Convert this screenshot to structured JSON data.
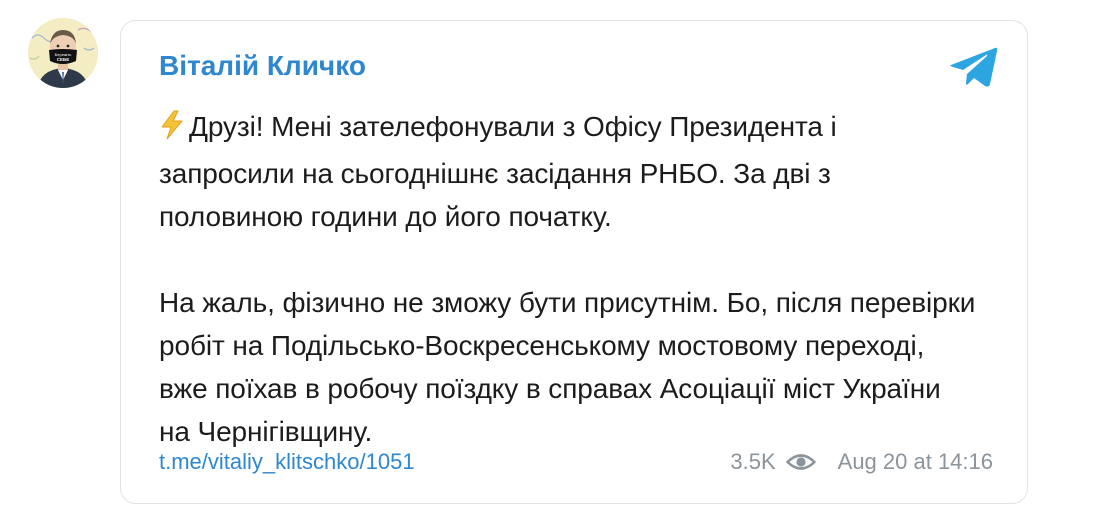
{
  "post": {
    "author_name": "Віталій Кличко",
    "message_paragraphs": [
      "Друзі! Мені зателефонували з Офісу Президента і запросили на сьогоднішнє засідання РНБО. За дві з половиною години до його початку.",
      "На жаль, фізично не зможу бути присутнім. Бо, після перевірки робіт на Подільсько-Воскресенському мостовому переході, вже поїхав в робочу поїздку в справах Асоціації міст України на Чернігівщину."
    ],
    "lead_emoji": "lightning-emoji",
    "link_text": "t.me/vitaliy_klitschko/1051",
    "views": "3.5K",
    "date": "Aug 20 at 14:16"
  },
  "avatar": {
    "mask_text_line1": "Бережіть",
    "mask_text_line2": "СЕБЕ"
  },
  "icons": {
    "platform": "telegram-logo-icon",
    "views": "eye-icon"
  },
  "colors": {
    "accent": "#2f87cf",
    "meta_text": "#8b949b",
    "telegram_blue": "#2ca5e0",
    "card_border": "#dfe3e6"
  }
}
